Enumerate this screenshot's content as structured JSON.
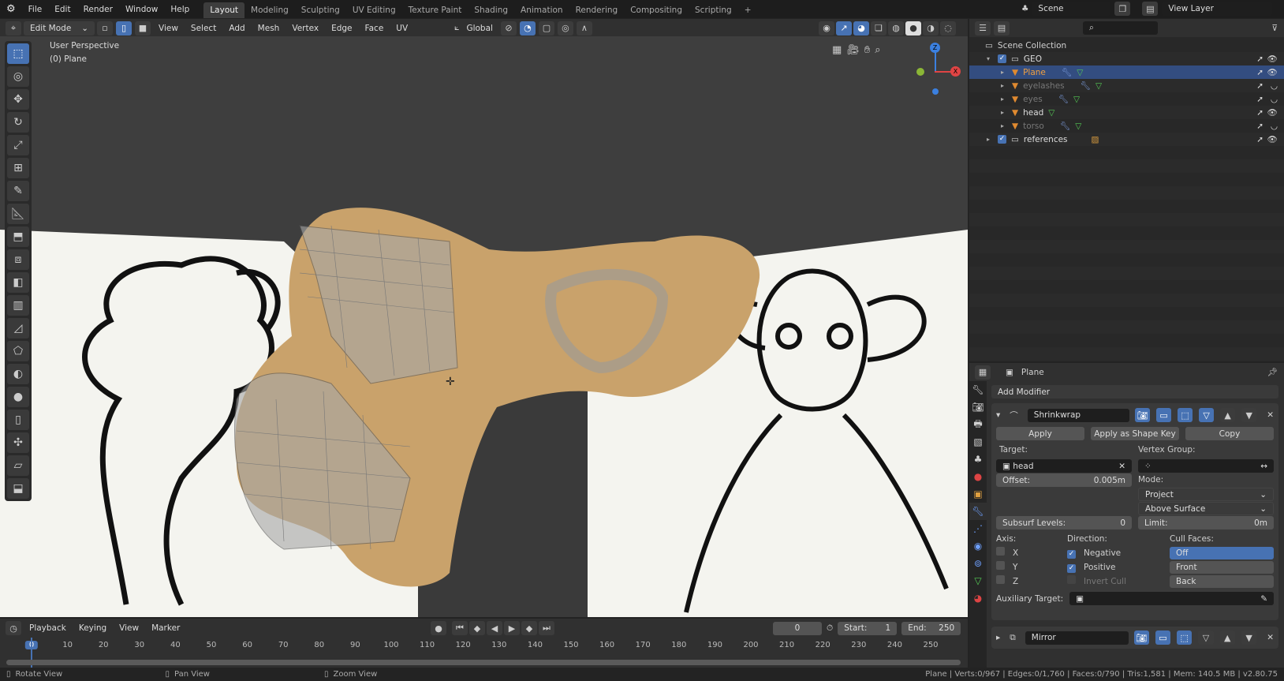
{
  "menu": [
    "File",
    "Edit",
    "Render",
    "Window",
    "Help"
  ],
  "workspaces": [
    "Layout",
    "Modeling",
    "Sculpting",
    "UV Editing",
    "Texture Paint",
    "Shading",
    "Animation",
    "Rendering",
    "Compositing",
    "Scripting"
  ],
  "scene": {
    "name": "Scene",
    "view_layer": "View Layer"
  },
  "viewport_header": {
    "mode": "Edit Mode",
    "menus": [
      "View",
      "Select",
      "Add",
      "Mesh",
      "Vertex",
      "Edge",
      "Face",
      "UV"
    ],
    "orientation": "Global"
  },
  "viewport": {
    "perspective": "User Perspective",
    "object": "(0) Plane",
    "gizmo": {
      "z": "Z",
      "x": "X"
    }
  },
  "outliner": {
    "root": "Scene Collection",
    "items": [
      {
        "name": "GEO",
        "level": 1,
        "type": "collection"
      },
      {
        "name": "Plane",
        "level": 2,
        "type": "mesh",
        "active": true
      },
      {
        "name": "eyelashes",
        "level": 2,
        "type": "mesh",
        "hidden": true
      },
      {
        "name": "eyes",
        "level": 2,
        "type": "mesh",
        "hidden": true
      },
      {
        "name": "head",
        "level": 2,
        "type": "mesh"
      },
      {
        "name": "torso",
        "level": 2,
        "type": "mesh",
        "hidden": true
      },
      {
        "name": "references",
        "level": 1,
        "type": "collection"
      }
    ]
  },
  "properties": {
    "object": "Plane",
    "add_modifier": "Add Modifier",
    "modifier": {
      "name": "Shrinkwrap",
      "apply": "Apply",
      "apply_shape": "Apply as Shape Key",
      "copy": "Copy",
      "target_label": "Target:",
      "target": "head",
      "vertex_group_label": "Vertex Group:",
      "offset_label": "Offset:",
      "offset": "0.005m",
      "mode_label": "Mode:",
      "mode": "Project",
      "surface": "Above Surface",
      "subsurf_label": "Subsurf Levels:",
      "subsurf": "0",
      "limit_label": "Limit:",
      "limit": "0m",
      "axis_label": "Axis:",
      "axes": [
        "X",
        "Y",
        "Z"
      ],
      "direction_label": "Direction:",
      "negative": "Negative",
      "positive": "Positive",
      "invert_cull": "Invert Cull",
      "cull_label": "Cull Faces:",
      "cull_options": [
        "Off",
        "Front",
        "Back"
      ],
      "aux_label": "Auxiliary Target:"
    },
    "modifier2": {
      "name": "Mirror"
    }
  },
  "timeline": {
    "menus": [
      "Playback",
      "Keying",
      "View",
      "Marker"
    ],
    "current": "0",
    "start_label": "Start:",
    "start": "1",
    "end_label": "End:",
    "end": "250",
    "ticks": [
      "0",
      "10",
      "20",
      "30",
      "40",
      "50",
      "60",
      "70",
      "80",
      "90",
      "100",
      "110",
      "120",
      "130",
      "140",
      "150",
      "160",
      "170",
      "180",
      "190",
      "200",
      "210",
      "220",
      "230",
      "240",
      "250"
    ]
  },
  "status": {
    "left": [
      "Rotate View",
      "Pan View",
      "Zoom View"
    ],
    "right": "Plane | Verts:0/967 | Edges:0/1,760 | Faces:0/790 | Tris:1,581 | Mem: 140.5 MB | v2.80.75"
  }
}
